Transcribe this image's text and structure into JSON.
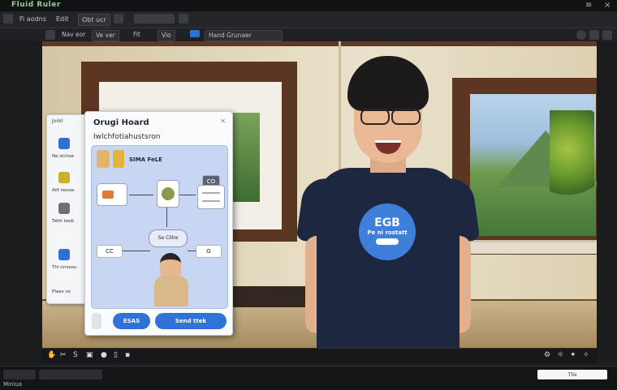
{
  "app": {
    "title": "Fluid Ruler",
    "window_controls": [
      "≡",
      "×"
    ]
  },
  "toolbar": {
    "items": [
      "Fi aodns",
      "Edit",
      "Obt ucr"
    ]
  },
  "row2": {
    "items": [
      "Nav eor",
      "Ve ver",
      "Fit",
      "Vio",
      "Hand Grunaer"
    ]
  },
  "viewport": {
    "shirt_logo_line1": "EGB",
    "shirt_logo_line2": "Pe ni rostatt"
  },
  "side_panel": {
    "title": "Jvrol",
    "items": [
      {
        "label": "Ne stchse",
        "icon": "blue-square-icon",
        "color": "#2f6fd6"
      },
      {
        "label": "Ailt reoow",
        "icon": "yellow-box-icon",
        "color": "#c8b028"
      },
      {
        "label": "Tahh teob",
        "icon": "grey-box-icon",
        "color": "#6d7077"
      },
      {
        "label": "Thi rsrseou",
        "icon": "blue-square-icon",
        "color": "#2f6fd6"
      },
      {
        "label": "Plaes ve",
        "icon": "",
        "color": ""
      }
    ]
  },
  "panel": {
    "title": "Orugi Hoard",
    "subtitle": "Iwlchfotiahustsron",
    "flow": {
      "header_label": "SIMA FeLE",
      "node_chip": "CO",
      "bubble": "Se Cillre",
      "bottom_chip_left": "CC",
      "bottom_chip_right": "G"
    },
    "buttons": {
      "primary": "ESAS",
      "secondary": "Send ttek"
    }
  },
  "timeline": {
    "left_text": "Miniua",
    "right_box": "Tlis"
  }
}
